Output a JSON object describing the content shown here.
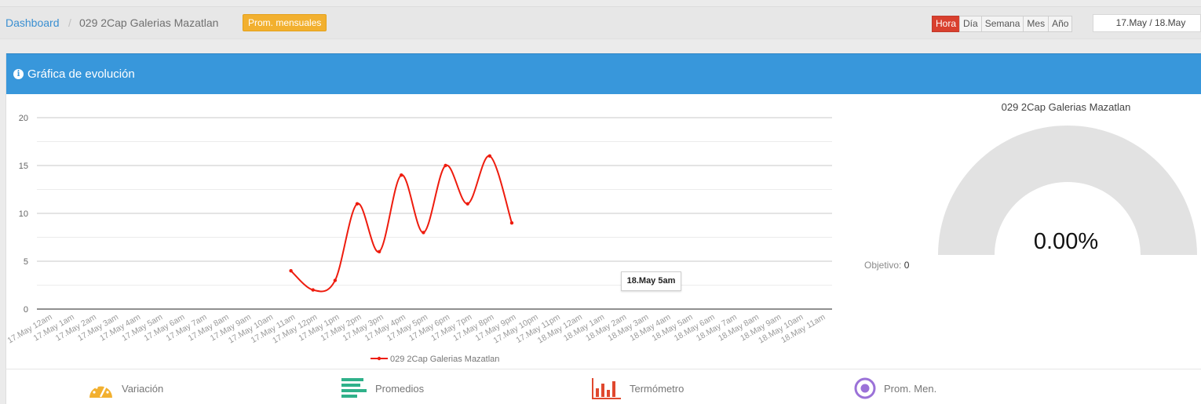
{
  "breadcrumb": {
    "home": "Dashboard",
    "separator": "/",
    "current": "029 2Cap Galerias Mazatlan",
    "badge": "Prom. mensuales"
  },
  "period": {
    "options": [
      "Hora",
      "Día",
      "Semana",
      "Mes",
      "Año"
    ],
    "active": "Hora",
    "range": "17.May / 18.May"
  },
  "panel": {
    "title": "Gráfica de evolución"
  },
  "chart_data": {
    "type": "line",
    "y_ticks": [
      0,
      5,
      10,
      15,
      20
    ],
    "ylim": [
      0,
      20
    ],
    "categories": [
      "17.May 12am",
      "17.May 1am",
      "17.May 2am",
      "17.May 3am",
      "17.May 4am",
      "17.May 5am",
      "17.May 6am",
      "17.May 7am",
      "17.May 8am",
      "17.May 9am",
      "17.May 10am",
      "17.May 11am",
      "17.May 12pm",
      "17.May 1pm",
      "17.May 2pm",
      "17.May 3pm",
      "17.May 4pm",
      "17.May 5pm",
      "17.May 6pm",
      "17.May 7pm",
      "17.May 8pm",
      "17.May 9pm",
      "17.May 10pm",
      "17.May 11pm",
      "18.May 12am",
      "18.May 1am",
      "18.May 2am",
      "18.May 3am",
      "18.May 4am",
      "18.May 5am",
      "18.May 6am",
      "18.May 7am",
      "18.May 8am",
      "18.May 9am",
      "18.May 10am",
      "18.May 11am"
    ],
    "series": [
      {
        "name": "029 2Cap Galerias Mazatlan",
        "color": "#ee1c0e",
        "values": [
          null,
          null,
          null,
          null,
          null,
          null,
          null,
          null,
          null,
          null,
          null,
          4,
          2,
          3,
          11,
          6,
          14,
          8,
          15,
          11,
          16,
          9,
          null,
          null,
          null,
          null,
          null,
          null,
          null,
          null,
          null,
          null,
          null,
          null,
          null,
          null
        ]
      }
    ],
    "legend": "bottom-center",
    "tooltip": "18.May 5am"
  },
  "gauge": {
    "title": "029 2Cap Galerias Mazatlan",
    "value": "0.00%",
    "fill_fraction": 0,
    "objetivo_label": "Objetivo:",
    "objetivo_value": "0"
  },
  "tools": [
    {
      "label": "Variación",
      "icon": "speedometer-icon",
      "color": "#f2b02f"
    },
    {
      "label": "Promedios",
      "icon": "bars-horizontal-icon",
      "color": "#2fb18a"
    },
    {
      "label": "Termómetro",
      "icon": "bar-chart-icon",
      "color": "#e0482e"
    },
    {
      "label": "Prom. Men.",
      "icon": "target-icon",
      "color": "#9b72d8"
    }
  ]
}
